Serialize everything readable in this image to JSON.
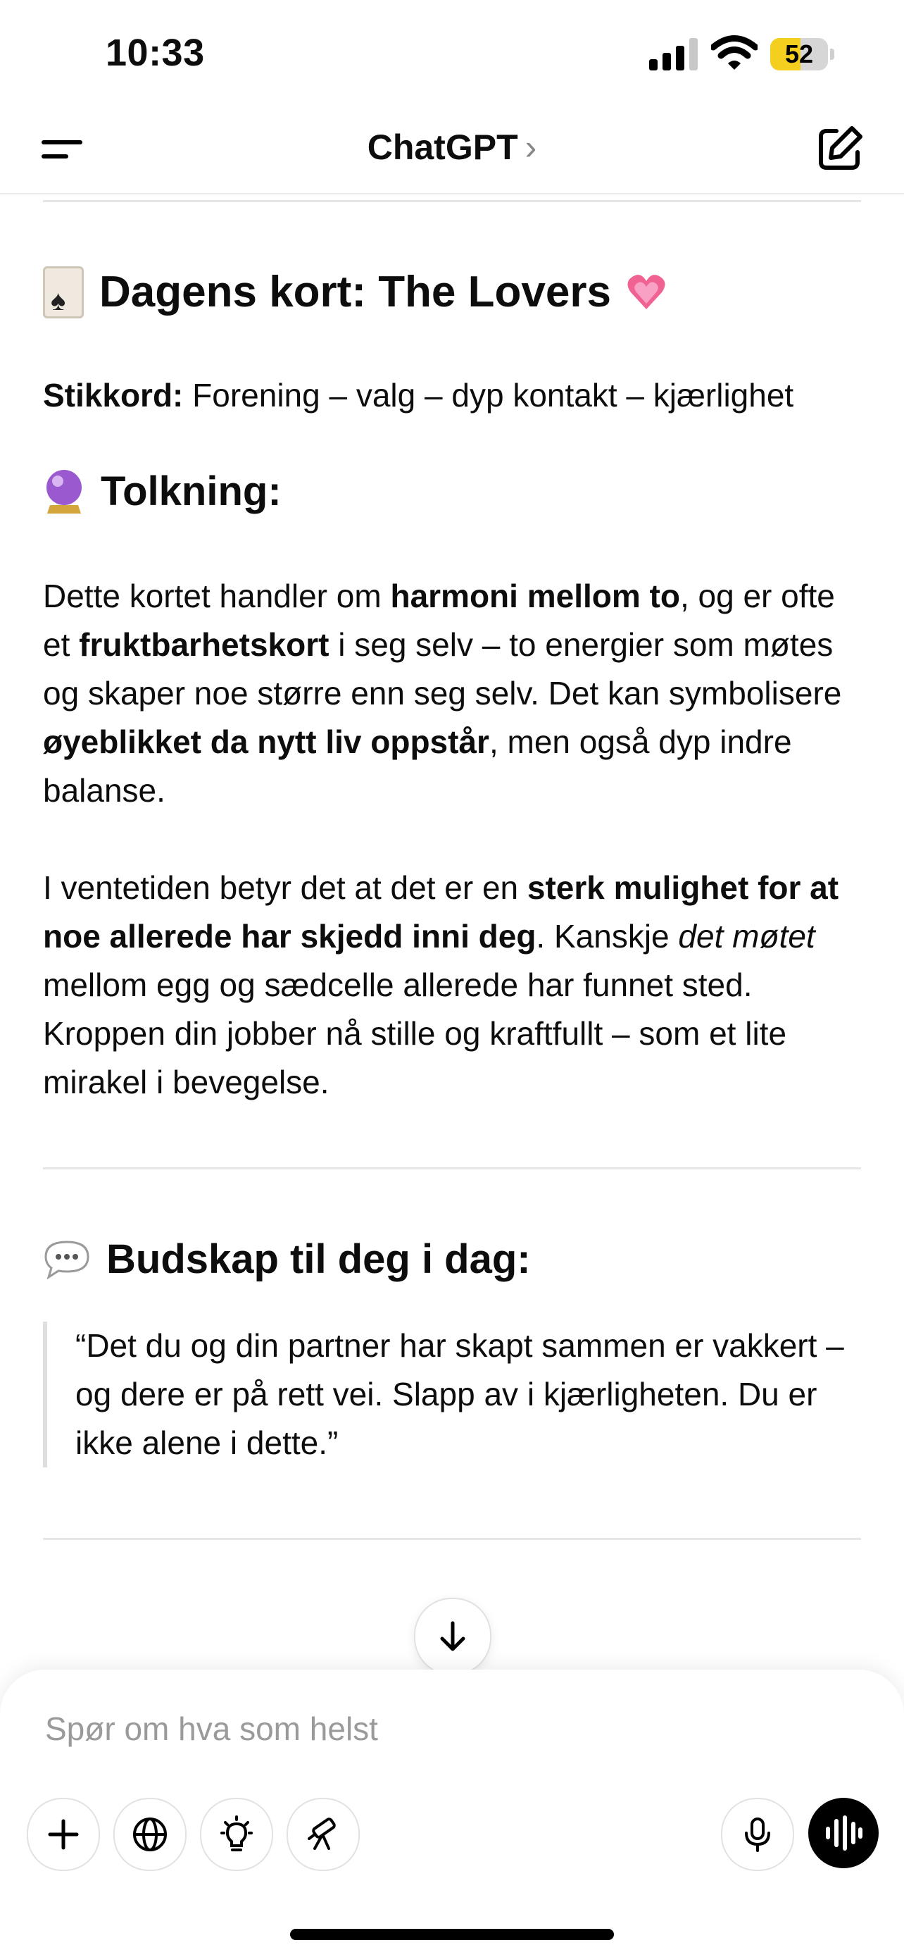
{
  "status_bar": {
    "time": "10:33",
    "battery": "52",
    "battery_level": 0.52
  },
  "nav": {
    "title": "ChatGPT",
    "chevron": "›"
  },
  "message": {
    "card_heading": "Dagens kort: The Lovers",
    "keywords_label": "Stikkord:",
    "keywords_text": " Forening – valg – dyp kontakt – kjærlighet",
    "interpretation_heading": "Tolkning:",
    "p1": {
      "t1": "Dette kortet handler om ",
      "b1": "harmoni mellom to",
      "t2": ", og er ofte et ",
      "b2": "fruktbarhetskort",
      "t3": " i seg selv – to energier som møtes og skaper noe større enn seg selv. Det kan symbolisere ",
      "b3": "øyeblikket da nytt liv oppstår",
      "t4": ", men også dyp indre balanse."
    },
    "p2": {
      "t1": "I ventetiden betyr det at det er en ",
      "b1": "sterk mulighet for at noe allerede har skjedd inni deg",
      "t2": ". Kanskje ",
      "i1": "det møtet",
      "t3": " mellom egg og sædcelle allerede har funnet sted. Kroppen din jobber nå stille og kraftfullt – som et lite mirakel i bevegelse."
    },
    "message_heading": "Budskap til deg i dag:",
    "quote": "“Det du og din partner har skapt sammen er vakkert – og dere er på rett vei. Slapp av i kjærligheten. Du er ikke alene i dette.”"
  },
  "composer": {
    "placeholder": "Spør om hva som helst"
  },
  "icons": {
    "card": "joker-card-icon",
    "heart": "sparkling-heart-icon",
    "ball": "crystal-ball-icon",
    "bubble": "speech-bubble-icon"
  },
  "colors": {
    "heart": "#f06292",
    "crystal": "#9b59d0",
    "battery": "#f5cf1e"
  }
}
